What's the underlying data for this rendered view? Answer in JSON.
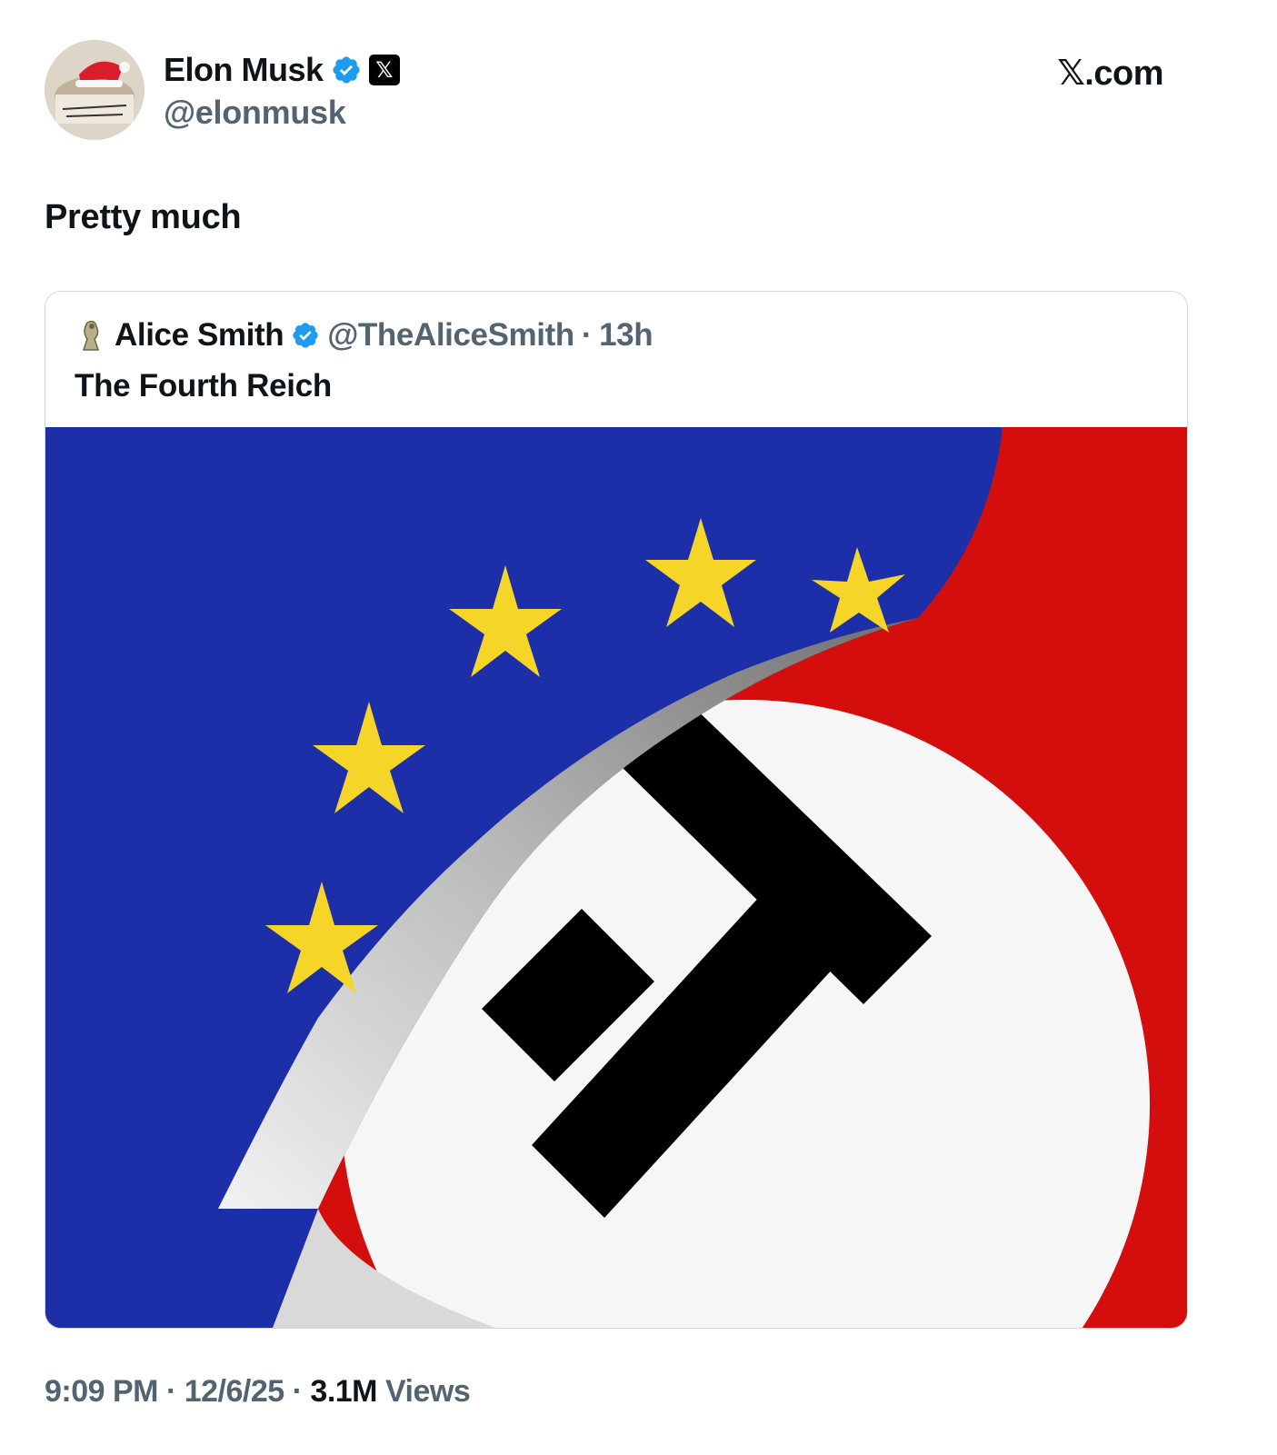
{
  "author": {
    "name": "Elon Musk",
    "handle": "@elonmusk",
    "verified_icon": "verified-badge-icon",
    "affiliate_icon": "x-logo-icon",
    "affiliate_glyph": "𝕏"
  },
  "site_label": "𝕏.com",
  "tweet": {
    "text": "Pretty much"
  },
  "quoted": {
    "name": "Alice Smith",
    "handle": "@TheAliceSmith",
    "separator": "·",
    "age": "13h",
    "text": "The Fourth Reich",
    "image_icon": "eu-flag-peeling-to-nazi-flag-image"
  },
  "footer": {
    "time": "9:09 PM",
    "sep1": "·",
    "date": "12/6/25",
    "sep2": "·",
    "views_count": "3.1M",
    "views_label": "Views"
  },
  "colors": {
    "verified": "#1d9bf0",
    "eu_blue": "#1d2fa8",
    "star_yellow": "#f4d528",
    "flag_red": "#d40d0d",
    "muted_text": "#536471"
  }
}
